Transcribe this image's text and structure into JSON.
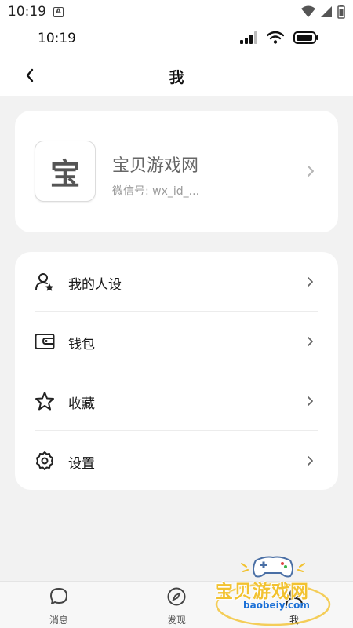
{
  "system_bar": {
    "time": "10:19",
    "notification_icon": "A"
  },
  "app_status": {
    "time": "10:19"
  },
  "header": {
    "title": "我",
    "back_icon": "chevron-left-icon"
  },
  "profile": {
    "avatar_char": "宝",
    "name": "宝贝游戏网",
    "wechat_id": "微信号: wx_id_..."
  },
  "menu": [
    {
      "label": "我的人设",
      "icon": "persona-icon"
    },
    {
      "label": "钱包",
      "icon": "wallet-icon"
    },
    {
      "label": "收藏",
      "icon": "star-icon"
    },
    {
      "label": "设置",
      "icon": "gear-icon"
    }
  ],
  "tabs": [
    {
      "label": "消息",
      "icon": "chat-bubble-icon"
    },
    {
      "label": "发现",
      "icon": "compass-icon"
    },
    {
      "label": "我",
      "icon": "user-icon"
    }
  ],
  "watermark": {
    "text": "宝贝游戏网",
    "url": "baobeiy.com"
  },
  "colors": {
    "background": "#f2f2f2",
    "card": "#ffffff",
    "watermark_yellow": "#f2c230",
    "watermark_blue": "#1a6fd6"
  }
}
